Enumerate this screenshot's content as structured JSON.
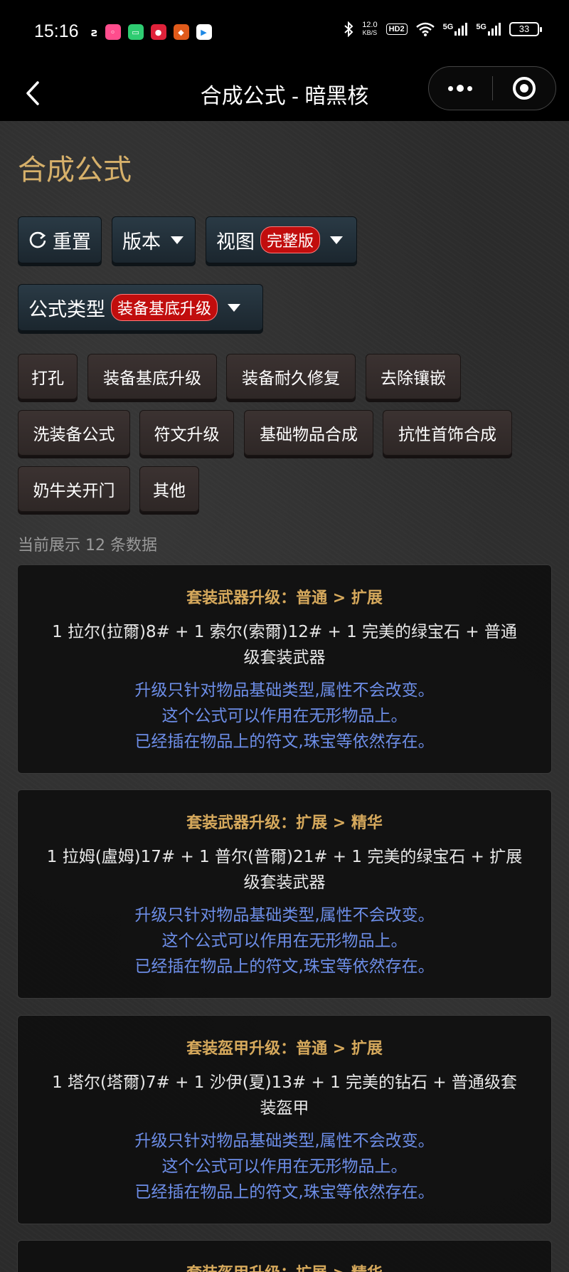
{
  "status_bar": {
    "time": "15:16",
    "net_speed_value": "12.0",
    "net_speed_unit": "KB/S",
    "hd": "HD2",
    "sim1": "5G",
    "sim2": "5G",
    "battery": "33"
  },
  "nav": {
    "title": "合成公式 - 暗黑核"
  },
  "page": {
    "title": "合成公式",
    "reset_label": "重置",
    "version_label": "版本",
    "view_label": "视图",
    "view_badge": "完整版",
    "formula_type_label": "公式类型",
    "formula_type_badge": "装备基底升级",
    "count_text": "当前展示 12 条数据"
  },
  "categories": [
    "打孔",
    "装备基底升级",
    "装备耐久修复",
    "去除镶嵌",
    "洗装备公式",
    "符文升级",
    "基础物品合成",
    "抗性首饰合成",
    "奶牛关开门",
    "其他"
  ],
  "cards": [
    {
      "title": "套装武器升级：普通 > 扩展",
      "recipe": "1 拉尔(拉爾)8# + 1 索尔(索爾)12# + 1 完美的绿宝石 + 普通级套装武器",
      "note1": "升级只针对物品基础类型,属性不会改变。",
      "note2": "这个公式可以作用在无形物品上。",
      "note3": "已经插在物品上的符文,珠宝等依然存在。"
    },
    {
      "title": "套装武器升级：扩展 > 精华",
      "recipe": "1 拉姆(盧姆)17# + 1 普尔(普爾)21# + 1 完美的绿宝石 + 扩展级套装武器",
      "note1": "升级只针对物品基础类型,属性不会改变。",
      "note2": "这个公式可以作用在无形物品上。",
      "note3": "已经插在物品上的符文,珠宝等依然存在。"
    },
    {
      "title": "套装盔甲升级：普通 > 扩展",
      "recipe": "1 塔尔(塔爾)7# + 1 沙伊(夏)13# + 1 完美的钻石 + 普通级套装盔甲",
      "note1": "升级只针对物品基础类型,属性不会改变。",
      "note2": "这个公式可以作用在无形物品上。",
      "note3": "已经插在物品上的符文,珠宝等依然存在。"
    },
    {
      "title": "套装盔甲升级：扩展 > 精华"
    }
  ]
}
